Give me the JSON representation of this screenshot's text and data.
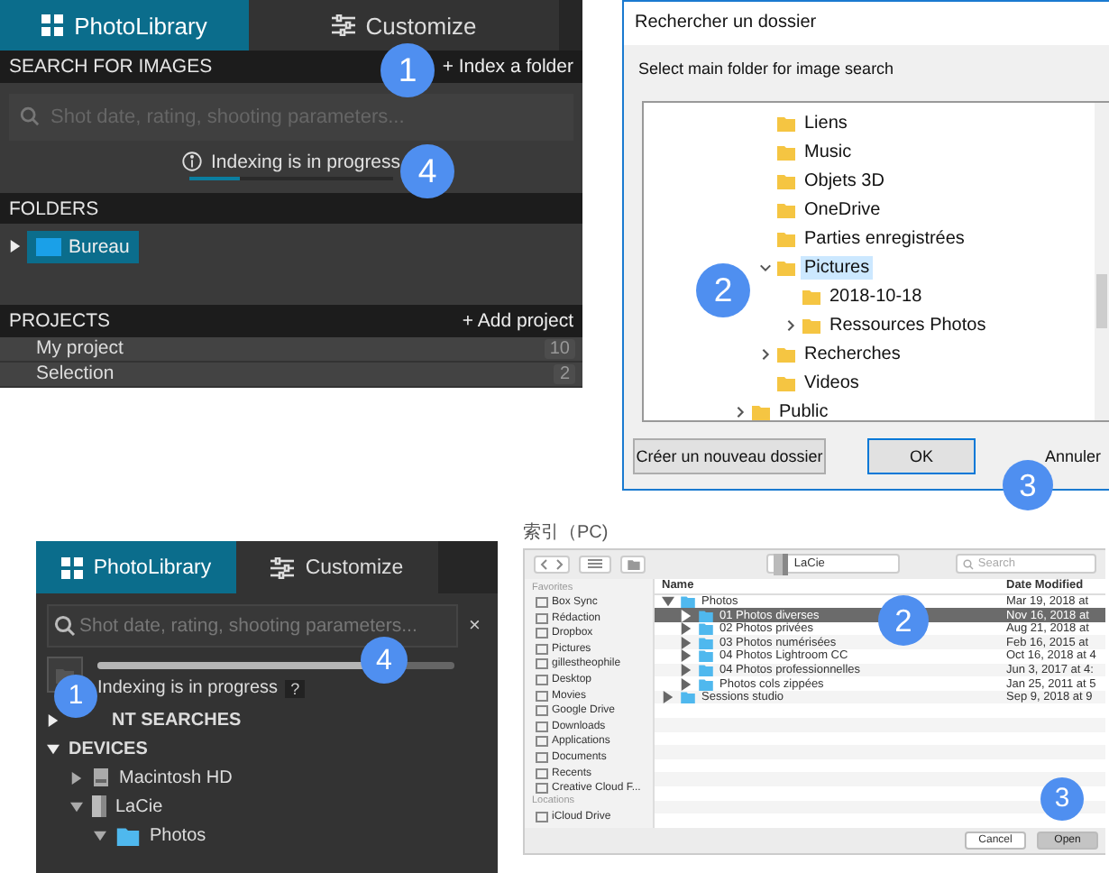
{
  "photolibrary_panel": {
    "tabs": [
      {
        "label": "PhotoLibrary",
        "selected": true
      },
      {
        "label": "Customize",
        "selected": false
      }
    ],
    "search_section": {
      "title": "SEARCH FOR IMAGES",
      "action": "+ Index a folder",
      "placeholder": "Shot date, rating, shooting parameters...",
      "status": "Indexing is in progress",
      "level": 0.25
    },
    "folders": {
      "title": "FOLDERS",
      "items": [
        {
          "label": "Bureau",
          "selected": true,
          "expanded": false
        }
      ]
    },
    "projects": {
      "title": "PROJECTS",
      "action": "+ Add project",
      "items": [
        {
          "name": "My project",
          "count": "10"
        },
        {
          "name": "Selection",
          "count": "2"
        }
      ]
    },
    "markers": [
      "1",
      "4"
    ]
  },
  "folder_dialog": {
    "title": "Rechercher un dossier",
    "prompt": "Select main folder for image search",
    "tree": [
      {
        "label": "Liens"
      },
      {
        "label": "Music"
      },
      {
        "label": "Objets 3D"
      },
      {
        "label": "OneDrive"
      },
      {
        "label": "Parties enregistrées"
      },
      {
        "label": "Pictures",
        "selected": true,
        "expanded": true,
        "children": [
          {
            "label": "2018-10-18"
          },
          {
            "label": "Ressources Photos",
            "expanded": false
          }
        ]
      },
      {
        "label": "Recherches",
        "expanded": false
      },
      {
        "label": "Videos"
      }
    ],
    "outer_tree": [
      {
        "label": "Public",
        "expanded": false
      }
    ],
    "buttons": [
      "Créer un nouveau dossier",
      "OK",
      "Annuler"
    ],
    "markers": [
      "2",
      "3"
    ]
  },
  "mac_panel": {
    "tabs": [
      {
        "label": "PhotoLibrary",
        "selected": true
      },
      {
        "label": "Customize",
        "selected": false
      }
    ],
    "placeholder": "Shot date, rating, shooting parameters...",
    "clear": "×",
    "level": 0.75,
    "status": "Indexing is in progress",
    "help": "?",
    "tree": [
      {
        "label": "NT SEARCHES",
        "expanded": false
      },
      {
        "label": "DEVICES",
        "expanded": true,
        "children": [
          {
            "label": "Macintosh HD",
            "kind": "disk",
            "expanded": false
          },
          {
            "label": "LaCie",
            "kind": "drive",
            "expanded": true,
            "children": [
              {
                "label": "Photos",
                "kind": "folder",
                "expanded": true
              }
            ]
          }
        ]
      }
    ],
    "markers": [
      "1",
      "4"
    ]
  },
  "caption": "索引（PC)",
  "mac_dialog": {
    "location": "LaCie",
    "search_placeholder": "Search",
    "sidebar": [
      {
        "title": "Favorites",
        "items": [
          "Box Sync",
          "Rédaction",
          "Dropbox",
          "Pictures",
          "gillestheophile",
          "Desktop",
          "Movies",
          "Google Drive",
          "Downloads",
          "Applications",
          "Documents",
          "Recents",
          "Creative Cloud F..."
        ]
      },
      {
        "title": "Locations",
        "items": [
          "iCloud Drive"
        ]
      }
    ],
    "columns": [
      "Name",
      "Date Modified"
    ],
    "rows": [
      {
        "name": "Photos",
        "date": "Mar 19, 2018 at",
        "expanded": true,
        "selected": false,
        "children": [
          {
            "name": "01 Photos diverses",
            "date": "Nov 16, 2018 at",
            "expanded": false,
            "selected": true
          },
          {
            "name": "02 Photos privées",
            "date": "Aug 21, 2018 at",
            "expanded": false,
            "selected": false
          },
          {
            "name": "03 Photos numérisées",
            "date": "Feb 16, 2015 at",
            "expanded": false,
            "selected": false
          },
          {
            "name": "04 Photos Lightroom CC",
            "date": "Oct 16, 2018 at 4",
            "expanded": false,
            "selected": false
          },
          {
            "name": "04 Photos professionnelles",
            "date": "Jun 3, 2017 at 4:",
            "expanded": false,
            "selected": false
          },
          {
            "name": "Photos cols zippées",
            "date": "Jan 25, 2011 at 5",
            "expanded": false,
            "selected": false
          }
        ]
      },
      {
        "name": "Sessions studio",
        "date": "Sep 9, 2018 at 9",
        "expanded": false,
        "selected": false
      }
    ],
    "buttons": [
      "Cancel",
      "Open"
    ],
    "markers": [
      "2",
      "3"
    ]
  }
}
